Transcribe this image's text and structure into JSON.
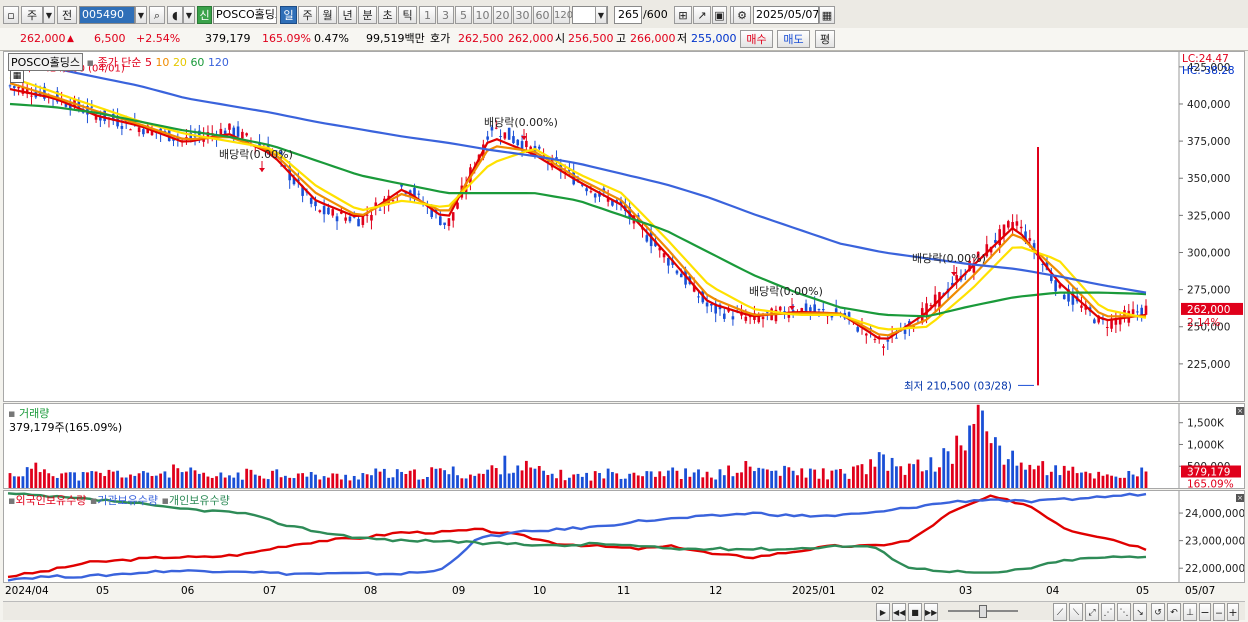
{
  "toolbar": {
    "type_label": "주",
    "whole_label": "전",
    "code": "005490",
    "stock_name": "POSCO홀딩스",
    "new_badge": "신",
    "period_tabs": [
      "일",
      "주",
      "월",
      "년",
      "분",
      "초",
      "틱"
    ],
    "active_tab": "일",
    "intervals": [
      "1",
      "3",
      "5",
      "10",
      "20",
      "30",
      "60",
      "120"
    ],
    "count": "265",
    "count_max": "/600",
    "date": "2025/05/07"
  },
  "quote": {
    "price": "262,000",
    "change": "6,500",
    "change_pct": "+2.54%",
    "volume": "379,179",
    "volume_ratio": "165.09%",
    "turnover": "0.47%",
    "amount": "99,519백만",
    "bid_label": "호가",
    "bid1": "262,500",
    "bid2": "262,000",
    "open_label": "시",
    "open": "256,500",
    "high_label": "고",
    "high": "266,000",
    "low_label": "저",
    "low": "255,000",
    "buy_label": "매수",
    "sell_label": "매도",
    "eval_label": "평"
  },
  "colors": {
    "up": "#e0001b",
    "down": "#1a4fd6",
    "ma5": "#e00000",
    "ma10": "#f08c00",
    "ma20": "#ffe100",
    "ma60": "#1a9a3a",
    "ma120": "#3a63dc",
    "foreign": "#e00000",
    "institution": "#3a63dc",
    "individual": "#2e8b57"
  },
  "price_panel": {
    "legend_name": "POSCO홀딩스",
    "legend_ma": "종가 단순",
    "ma_periods": [
      "5",
      "10",
      "20",
      "60",
      "120"
    ],
    "lc": "LC:24.47",
    "hc": "HC:-38.28",
    "y_ticks": [
      "425,000",
      "400,000",
      "375,000",
      "350,000",
      "325,000",
      "300,000",
      "275,000",
      "250,000",
      "225,000"
    ],
    "current_tag": "262,000",
    "pct_tag": "2.14%",
    "high_label": "최고 424,500 (04/01)",
    "low_label": "최저 210,500 (03/28)",
    "dividend_labels": [
      "배당락(0.00%)",
      "배당락(0.00%)",
      "배당락(0.00%)",
      "배당락(0.00%)"
    ]
  },
  "volume_panel": {
    "legend": "거래량",
    "value_text": "379,179주(165.09%)",
    "y_ticks": [
      "1,500K",
      "1,000K",
      "500,000"
    ],
    "current_tag": "379,179",
    "pct_tag": "165.09%"
  },
  "holdings_panel": {
    "legends": [
      "외국인보유수량",
      "기관보유수량",
      "개인보유수량"
    ],
    "y_ticks": [
      "24,000,000",
      "23,000,000",
      "22,000,000"
    ]
  },
  "x_axis": {
    "labels": [
      "2024/04",
      "05",
      "06",
      "07",
      "08",
      "09",
      "10",
      "11",
      "12",
      "2025/01",
      "02",
      "03",
      "04",
      "05"
    ],
    "right_label": "05/07"
  },
  "chart_data": [
    {
      "type": "candlestick",
      "title": "POSCO홀딩스",
      "y_axis_ticks": [
        225000,
        250000,
        275000,
        300000,
        325000,
        350000,
        375000,
        400000,
        425000
      ],
      "ylim": [
        200000,
        435000
      ],
      "period": "2024/04 - 2025/05",
      "x_labels": [
        "2024/04",
        "05",
        "06",
        "07",
        "08",
        "09",
        "10",
        "11",
        "12",
        "2025/01",
        "02",
        "03",
        "04",
        "05"
      ],
      "close_series": [
        412000,
        405000,
        392000,
        384000,
        376000,
        383000,
        368000,
        328000,
        322000,
        345000,
        318000,
        385000,
        368000,
        348000,
        330000,
        297000,
        262000,
        255000,
        262000,
        258000,
        238000,
        262000,
        292000,
        322000,
        275000,
        252000,
        262000
      ],
      "ma_lines": [
        {
          "name": "5",
          "values": [
            410000,
            404000,
            392000,
            385000,
            374000,
            380000,
            366000,
            335000,
            323000,
            343000,
            322000,
            378000,
            366000,
            348000,
            332000,
            300000,
            266000,
            257000,
            260000,
            259000,
            240000,
            260000,
            290000,
            318000,
            280000,
            254000,
            258000
          ]
        },
        {
          "name": "10",
          "values": [
            414000,
            405000,
            395000,
            386000,
            376000,
            378000,
            368000,
            340000,
            324000,
            340000,
            326000,
            372000,
            368000,
            350000,
            335000,
            304000,
            270000,
            258000,
            259000,
            259000,
            243000,
            255000,
            283000,
            314000,
            287000,
            257000,
            257000
          ]
        },
        {
          "name": "20",
          "values": [
            418000,
            408000,
            398000,
            388000,
            380000,
            375000,
            370000,
            345000,
            328000,
            335000,
            330000,
            360000,
            370000,
            353000,
            340000,
            310000,
            278000,
            262000,
            258000,
            258000,
            248000,
            250000,
            275000,
            305000,
            295000,
            262000,
            256000
          ]
        },
        {
          "name": "60",
          "values": [
            400000,
            398000,
            394000,
            388000,
            382000,
            378000,
            372000,
            362000,
            352000,
            346000,
            340000,
            340000,
            340000,
            335000,
            325000,
            315000,
            300000,
            285000,
            273000,
            263000,
            258000,
            257000,
            264000,
            270000,
            273000,
            273000,
            272000
          ]
        },
        {
          "name": "120",
          "values": [
            430000,
            424000,
            418000,
            412000,
            404000,
            399000,
            394000,
            388000,
            383000,
            378000,
            374000,
            369000,
            365000,
            360000,
            353000,
            346000,
            337000,
            326000,
            316000,
            306000,
            300000,
            296000,
            292000,
            289000,
            284000,
            278000,
            273000
          ]
        }
      ],
      "annotations": [
        "최고 424,500 (04/01)",
        "최저 210,500 (03/28)",
        "배당락(0.00%)"
      ],
      "current_price": 262000
    },
    {
      "type": "bar",
      "title": "거래량",
      "y_axis_ticks": [
        500000,
        1000000,
        1500000
      ],
      "ylim": [
        0,
        1700000
      ],
      "latest_value": 379179,
      "values": [
        320000,
        480000,
        280000,
        360000,
        300000,
        420000,
        250000,
        330000,
        380000,
        290000,
        270000,
        350000,
        310000,
        410000,
        300000,
        620000,
        340000,
        280000,
        350000,
        420000,
        360000,
        300000,
        480000,
        390000,
        370000,
        330000,
        620000,
        460000,
        700000,
        1600000,
        640000,
        480000,
        350000,
        300000,
        379179
      ]
    },
    {
      "type": "line",
      "title": "외국인보유수량 / 기관보유수량 / 개인보유수량",
      "y_axis_ticks": [
        22000000,
        23000000,
        24000000
      ],
      "ylim": [
        21500000,
        24800000
      ],
      "series": [
        {
          "name": "외국인보유수량",
          "values": [
            21700000,
            21900000,
            22200000,
            22300000,
            22400000,
            22400000,
            22500000,
            22800000,
            23000000,
            23100000,
            23300000,
            23300000,
            23400000,
            23200000,
            22900000,
            22800000,
            22700000,
            22800000,
            22500000,
            22400000,
            22600000,
            22800000,
            22800000,
            23000000,
            24000000,
            24600000,
            24300000,
            23400000,
            23100000,
            22700000
          ]
        },
        {
          "name": "기관보유수량",
          "values": [
            21600000,
            21700000,
            21700000,
            21800000,
            21900000,
            21900000,
            21900000,
            21800000,
            21800000,
            21800000,
            21800000,
            21900000,
            23100000,
            23300000,
            23400000,
            23500000,
            23700000,
            23800000,
            23900000,
            24000000,
            23900000,
            23900000,
            24000000,
            24200000,
            24400000,
            24500000,
            24400000,
            24500000,
            24600000,
            24700000
          ]
        },
        {
          "name": "개인보유수량",
          "values": [
            24700000,
            24600000,
            24500000,
            24400000,
            24200000,
            24100000,
            24000000,
            23600000,
            23300000,
            23100000,
            23000000,
            23000000,
            22900000,
            22900000,
            22800000,
            22900000,
            22800000,
            22700000,
            22700000,
            22700000,
            22700000,
            22800000,
            22800000,
            22000000,
            21900000,
            21800000,
            22000000,
            22300000,
            22400000,
            22400000
          ]
        }
      ]
    }
  ]
}
